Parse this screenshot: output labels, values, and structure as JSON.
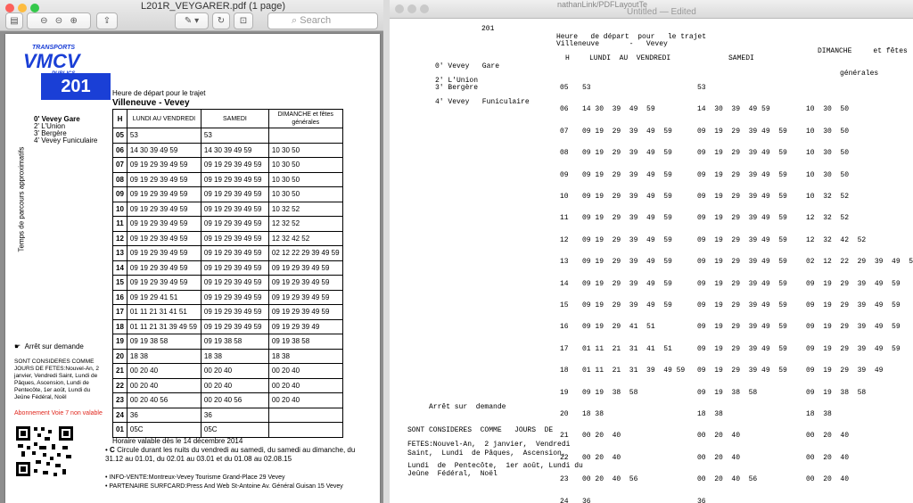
{
  "preview_window": {
    "title": "L201R_VEYGARER.pdf (1 page)",
    "search_placeholder": "Search"
  },
  "pdf": {
    "logo_line1": "TRANSPORTS",
    "logo_main": "VMCV",
    "logo_line3": "PUBLICS",
    "line_number": "201",
    "heading": "Heure de départ pour le trajet",
    "route": "Villeneuve - Vevey",
    "col_h": "H",
    "col_weekday": "LUNDI AU VENDREDI",
    "col_saturday": "SAMEDI",
    "col_sunday": "DIMANCHE et fêtes générales",
    "stops": [
      "0' Vevey Gare",
      "2' L'Union",
      "3' Bergère",
      "4' Vevey Funiculaire"
    ],
    "vertical_label": "Temps de parcours approximatifs",
    "rows": [
      [
        "05",
        "53",
        "53",
        ""
      ],
      [
        "06",
        "14 30 39 49 59",
        "14 30 39 49 59",
        "10 30 50"
      ],
      [
        "07",
        "09 19 29 39 49 59",
        "09 19 29 39 49 59",
        "10 30 50"
      ],
      [
        "08",
        "09 19 29 39 49 59",
        "09 19 29 39 49 59",
        "10 30 50"
      ],
      [
        "09",
        "09 19 29 39 49 59",
        "09 19 29 39 49 59",
        "10 30 50"
      ],
      [
        "10",
        "09 19 29 39 49 59",
        "09 19 29 39 49 59",
        "10 32 52"
      ],
      [
        "11",
        "09 19 29 39 49 59",
        "09 19 29 39 49 59",
        "12 32 52"
      ],
      [
        "12",
        "09 19 29 39 49 59",
        "09 19 29 39 49 59",
        "12 32 42 52"
      ],
      [
        "13",
        "09 19 29 39 49 59",
        "09 19 29 39 49 59",
        "02 12 22 29 39 49 59"
      ],
      [
        "14",
        "09 19 29 39 49 59",
        "09 19 29 39 49 59",
        "09 19 29 39 49 59"
      ],
      [
        "15",
        "09 19 29 39 49 59",
        "09 19 29 39 49 59",
        "09 19 29 39 49 59"
      ],
      [
        "16",
        "09 19 29 41 51",
        "09 19 29 39 49 59",
        "09 19 29 39 49 59"
      ],
      [
        "17",
        "01 11 21 31 41 51",
        "09 19 29 39 49 59",
        "09 19 29 39 49 59"
      ],
      [
        "18",
        "01 11 21 31 39 49 59",
        "09 19 29 39 49 59",
        "09 19 29 39 49"
      ],
      [
        "19",
        "09 19 38 58",
        "09 19 38 58",
        "09 19 38 58"
      ],
      [
        "20",
        "18 38",
        "18 38",
        "18 38"
      ],
      [
        "21",
        "00 20 40",
        "00 20 40",
        "00 20 40"
      ],
      [
        "22",
        "00 20 40",
        "00 20 40",
        "00 20 40"
      ],
      [
        "23",
        "00 20 40 56",
        "00 20 40 56",
        "00 20 40"
      ],
      [
        "24",
        "36",
        "36",
        ""
      ],
      [
        "01",
        "05C",
        "05C",
        ""
      ]
    ],
    "request_stop": "Arrêt sur demande",
    "holidays_text": "SONT CONSIDERES COMME JOURS DE FETES:Nouvel-An, 2 janvier, Vendredi Saint, Lundi de Pâques, Ascension, Lundi de Pentecôte, 1er août, Lundi du Jeûne Fédéral, Noël",
    "subscription_note": "Abonnement Voie 7 non valable",
    "valid_from": "Horaire valable dès le 14 décembre 2014",
    "note_c": "Circule durant les nuits du vendredi au samedi, du samedi au dimanche, du 31.12 au 01.01, du 02.01 au 03.01 et du 01.08 au 02.08.15",
    "note_c_marker": "C",
    "info_vente": "INFO-VENTE:Montreux-Vevey Tourisme Grand-Place 29 Vevey",
    "partenaire": "PARTENAIRE SURFCARD:Press And Web St-Antoine Av. Général Guisan 15 Vevey"
  },
  "textedit_window": {
    "title": "Untitled",
    "edited": "— Edited",
    "bg_tab": "nathanLink/PDFLayoutTe",
    "header_201": "201",
    "header_line1": "Heure   de départ  pour   le trajet",
    "header_line2": "Villeneuve       -   Vevey",
    "col_sunday1": "DIMANCHE     et fêtes",
    "col_sunday2": "générales",
    "col_h": "H",
    "col_weekday": "LUNDI  AU  VENDREDI",
    "col_saturday": "SAMEDI",
    "stop0": "0' Vevey   Gare",
    "stop1": "2' L'Union",
    "stop2": "3' Bergère",
    "stop3": "4' Vevey   Funiculaire",
    "request": "Arrêt sur  demande",
    "hol1": "SONT CONSIDERES  COMME   JOURS  DE",
    "hol2": "FETES:Nouvel-An,  2 janvier,  Vendredi",
    "hol3": "Saint,  Lundi  de Pâques,  Ascension,",
    "hol4": "Lundi  de  Pentecôte,  1er août, Lundi du",
    "hol5": "Jeûne  Fédéral,  Noël",
    "rows": [
      [
        "05",
        "53",
        "53",
        ""
      ],
      [
        "06",
        "14 30  39  49  59",
        "14  30  39  49 59",
        "10  30  50"
      ],
      [
        "07",
        "09 19  29  39  49  59",
        "09  19  29  39 49  59",
        "10  30  50"
      ],
      [
        "08",
        "09 19  29  39  49  59",
        "09  19  29  39 49  59",
        "10  30  50"
      ],
      [
        "09",
        "09 19  29  39  49  59",
        "09  19  29  39 49  59",
        "10  30  50"
      ],
      [
        "10",
        "09 19  29  39  49  59",
        "09  19  29  39 49  59",
        "10  32  52"
      ],
      [
        "11",
        "09 19  29  39  49  59",
        "09  19  29  39 49  59",
        "12  32  52"
      ],
      [
        "12",
        "09 19  29  39  49  59",
        "09  19  29  39 49  59",
        "12  32  42  52"
      ],
      [
        "13",
        "09 19  29  39  49  59",
        "09  19  29  39 49  59",
        "02  12  22  29  39  49  59"
      ],
      [
        "14",
        "09 19  29  39  49  59",
        "09  19  29  39 49  59",
        "09  19  29  39  49  59"
      ],
      [
        "15",
        "09 19  29  39  49  59",
        "09  19  29  39 49  59",
        "09  19  29  39  49  59"
      ],
      [
        "16",
        "09 19  29  41  51",
        "09  19  29  39 49  59",
        "09  19  29  39  49  59"
      ],
      [
        "17",
        "01 11  21  31  41  51",
        "09  19  29  39 49  59",
        "09  19  29  39  49  59"
      ],
      [
        "18",
        "01 11  21  31  39  49 59",
        "09  19  29  39 49  59",
        "09  19  29  39  49"
      ],
      [
        "19",
        "09 19  38  58",
        "09  19  38  58",
        "09  19  38  58"
      ],
      [
        "20",
        "18 38",
        "18  38",
        "18  38"
      ],
      [
        "21",
        "00 20  40",
        "00  20  40",
        "00  20  40"
      ],
      [
        "22",
        "00 20  40",
        "00  20  40",
        "00  20  40"
      ],
      [
        "23",
        "00 20  40  56",
        "00  20  40  56",
        "00  20  40"
      ],
      [
        "24",
        "36",
        "36",
        ""
      ]
    ]
  }
}
